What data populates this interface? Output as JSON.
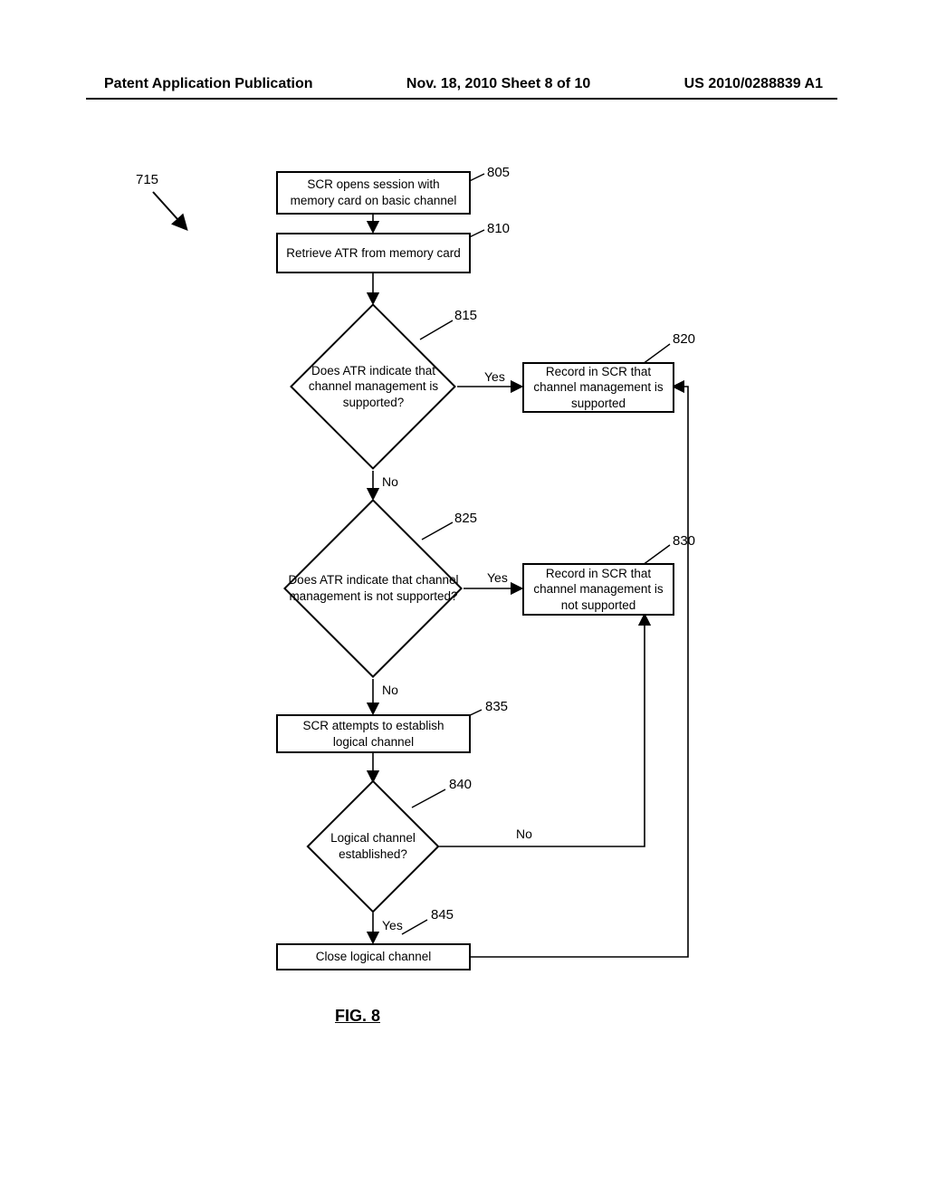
{
  "header": {
    "left": "Patent Application Publication",
    "center": "Nov. 18, 2010  Sheet 8 of 10",
    "right": "US 2010/0288839 A1"
  },
  "refs": {
    "r715": "715",
    "r805": "805",
    "r810": "810",
    "r815": "815",
    "r820": "820",
    "r825": "825",
    "r830": "830",
    "r835": "835",
    "r840": "840",
    "r845": "845"
  },
  "boxes": {
    "b805": "SCR opens session with memory card on basic channel",
    "b810": "Retrieve ATR from memory card",
    "b815": "Does ATR indicate that channel management is supported?",
    "b820": "Record in SCR that channel management is supported",
    "b825": "Does ATR indicate that channel management is not supported?",
    "b830": "Record in SCR that channel management is not supported",
    "b835": "SCR attempts to establish logical channel",
    "b840": "Logical channel established?",
    "b845": "Close logical channel"
  },
  "labels": {
    "yes": "Yes",
    "no": "No"
  },
  "figure": "FIG. 8"
}
